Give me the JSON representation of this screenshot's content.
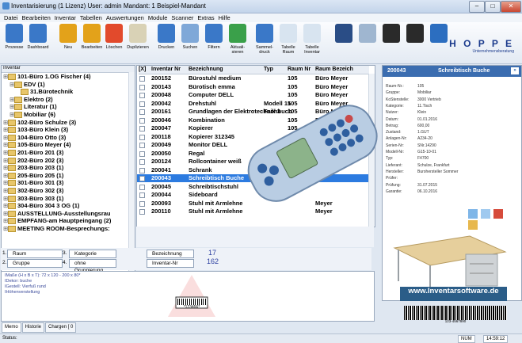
{
  "window": {
    "title": "Inventarisierung (1 Lizenz)  User: admin  Mandant: 1 Beispiel-Mandant"
  },
  "menu": [
    "Datei",
    "Bearbeiten",
    "Inventar",
    "Tabellen",
    "Auswertungen",
    "Module",
    "Scanner",
    "Extras",
    "Hilfe"
  ],
  "toolbar": [
    {
      "label": "Prozesse",
      "icon": "process-icon",
      "color": "#3a78c8"
    },
    {
      "label": "Dashboard",
      "icon": "dashboard-icon",
      "color": "#3a78c8"
    },
    {
      "label": "Neu",
      "icon": "new-icon",
      "color": "#e3a21a"
    },
    {
      "label": "Bearbeiten",
      "icon": "edit-icon",
      "color": "#e3a21a"
    },
    {
      "label": "Löschen",
      "icon": "delete-icon",
      "color": "#e24a2c"
    },
    {
      "label": "Duplizieren",
      "icon": "duplicate-icon",
      "color": "#d9d2b6"
    },
    {
      "label": "Drucken",
      "icon": "print-icon",
      "color": "#3a78c8"
    },
    {
      "label": "Suchen",
      "icon": "search-icon",
      "color": "#7fa8d8"
    },
    {
      "label": "Filtern",
      "icon": "filter-icon",
      "color": "#3a78c8"
    },
    {
      "label": "Aktuali- sieren",
      "icon": "refresh-icon",
      "color": "#3aa04a"
    },
    {
      "label": "Sammel- druck",
      "icon": "batch-print-icon",
      "color": "#3a78c8"
    },
    {
      "label": "Tabelle Raum",
      "icon": "table-room-icon",
      "color": "#d8e4f0"
    },
    {
      "label": "Tabelle Inventar",
      "icon": "table-inventory-icon",
      "color": "#d8e4f0"
    },
    {
      "label": "",
      "icon": "phone-icon",
      "color": "#2a4d86"
    },
    {
      "label": "",
      "icon": "scanner-icon",
      "color": "#9fb6d0"
    },
    {
      "label": "",
      "icon": "rfid-icon",
      "color": "#2a2a2a"
    },
    {
      "label": "",
      "icon": "camera-icon",
      "color": "#2a2a2a"
    },
    {
      "label": "",
      "icon": "help-icon",
      "color": "#2c6ec0"
    }
  ],
  "brand": {
    "name": "H O P P E",
    "tagline": "Unternehmensberatung"
  },
  "tree": {
    "header": "Inventar",
    "nodes": [
      {
        "label": "101-Büro 1.OG  Fischer  (4)",
        "level": 0
      },
      {
        "label": "EDV  (1)",
        "level": 1
      },
      {
        "label": "31.Bürotechnik",
        "level": 2
      },
      {
        "label": "Elektro  (2)",
        "level": 1
      },
      {
        "label": "Literatur  (1)",
        "level": 1
      },
      {
        "label": "Mobiliar  (6)",
        "level": 1
      },
      {
        "label": "102-Büro  Schulze  (3)",
        "level": 0
      },
      {
        "label": "103-Büro Klein  (3)",
        "level": 0
      },
      {
        "label": "104-Büro  Otto  (3)",
        "level": 0
      },
      {
        "label": "105-Büro  Meyer  (4)",
        "level": 0
      },
      {
        "label": "201-Büro 201  (3)",
        "level": 0
      },
      {
        "label": "202-Büro 202  (3)",
        "level": 0
      },
      {
        "label": "203-Büro 203  (1)",
        "level": 0
      },
      {
        "label": "205-Büro 205  (1)",
        "level": 0
      },
      {
        "label": "301-Büro 301  (3)",
        "level": 0
      },
      {
        "label": "302-Büro 302  (3)",
        "level": 0
      },
      {
        "label": "303-Büro 303  (1)",
        "level": 0
      },
      {
        "label": "304-Büro 304  3 OG  (1)",
        "level": 0
      },
      {
        "label": "AUSSTELLUNG-Ausstellungsrau",
        "level": 0
      },
      {
        "label": "EMPFANG-am Hauptpeingang  (2)",
        "level": 0
      },
      {
        "label": "MEETING ROOM-Besprechungs:",
        "level": 0
      }
    ]
  },
  "grid": {
    "columns": [
      "[X]",
      "Inventar Nr",
      "Bezeichnung",
      "Typ",
      "Raum Nr",
      "Raum Bezeich"
    ],
    "rows": [
      {
        "nr": "200152",
        "bez": "Bürostuhl medium",
        "typ": "",
        "raum": "105",
        "rbez": "Büro  Meyer"
      },
      {
        "nr": "200143",
        "bez": "Bürotisch emma",
        "typ": "",
        "raum": "105",
        "rbez": "Büro  Meyer"
      },
      {
        "nr": "200048",
        "bez": "Computer DELL",
        "typ": "",
        "raum": "105",
        "rbez": "Büro  Meyer"
      },
      {
        "nr": "200042",
        "bez": "Drehstuhl",
        "typ": "Modell 15",
        "raum": "105",
        "rbez": "Büro  Meyer"
      },
      {
        "nr": "200161",
        "bez": "Grundlagen der Elektrotechnik 3",
        "typ": "Fachbuch",
        "raum": "105",
        "rbez": "Büro  Meyer"
      },
      {
        "nr": "200046",
        "bez": "Kombination",
        "typ": "",
        "raum": "105",
        "rbez": "Büro  Meyer"
      },
      {
        "nr": "200047",
        "bez": "Kopierer",
        "typ": "",
        "raum": "105",
        "rbez": "Büro  Meyer"
      },
      {
        "nr": "200118",
        "bez": "Kopierer 312345",
        "typ": "",
        "raum": "105",
        "rbez": ""
      },
      {
        "nr": "200049",
        "bez": "Monitor DELL",
        "typ": "",
        "raum": "",
        "rbez": ""
      },
      {
        "nr": "200050",
        "bez": "Regal",
        "typ": "",
        "raum": "",
        "rbez": ""
      },
      {
        "nr": "200124",
        "bez": "Rollcontainer weiß",
        "typ": "",
        "raum": "",
        "rbez": ""
      },
      {
        "nr": "200041",
        "bez": "Schrank",
        "typ": "Mo",
        "raum": "",
        "rbez": ""
      },
      {
        "nr": "200043",
        "bez": "Schreibtisch Buche",
        "typ": "",
        "raum": "",
        "rbez": "",
        "selected": true
      },
      {
        "nr": "200045",
        "bez": "Schreibtischstuhl",
        "typ": "",
        "raum": "",
        "rbez": ""
      },
      {
        "nr": "200044",
        "bez": "Sideboard",
        "typ": "",
        "raum": "",
        "rbez": ""
      },
      {
        "nr": "200093",
        "bez": "Stuhl mit Armlehne",
        "typ": "",
        "raum": "",
        "rbez": "Meyer"
      },
      {
        "nr": "200110",
        "bez": "Stuhl mit Armlehne",
        "typ": "",
        "raum": "",
        "rbez": "Meyer"
      }
    ]
  },
  "grouping": {
    "row1": {
      "a_num": "1.",
      "a": "Raum",
      "b_num": "3.",
      "b": "Kategorie",
      "c": "Bezeichnung",
      "count": "17"
    },
    "row2": {
      "a_num": "2.",
      "a": "Gruppe",
      "b_num": "4.",
      "b": "ohne Gruppierung",
      "c": "Inventar-Nr",
      "count": "162"
    }
  },
  "memo": {
    "lines": [
      "IMaße (H x B x T): 72 x 120 - 200 x 80*",
      "IDekor: buche",
      "IGestell: Vierfuß rund",
      "IHöhenverstellung"
    ]
  },
  "barcode_text": "*123456*",
  "tabs": [
    "Memo",
    "Historie",
    "Chargen [ 0"
  ],
  "status": {
    "left": "Status:",
    "num": "NUM",
    "time": "14:59:12"
  },
  "detail": {
    "nr": "200043",
    "title": "Schreibtisch Buche",
    "fields": [
      {
        "k": "Raum-Nr.:",
        "v": "105"
      },
      {
        "k": "Gruppe:",
        "v": "Mobiliar"
      },
      {
        "k": "KoStenstelle:",
        "v": "3000 Vertrieb"
      },
      {
        "k": "Kategorie:",
        "v": "11.Tisch"
      },
      {
        "k": "Nutzer:",
        "v": "Klein"
      },
      {
        "k": "Datum:",
        "v": "01.01.2016"
      },
      {
        "k": "Betrag:",
        "v": "600,00"
      },
      {
        "k": "Zustand:",
        "v": "1.GUT"
      },
      {
        "k": "Anlagen-Nr:",
        "v": "A234-20"
      },
      {
        "k": "Serien-Nr:",
        "v": "SNr.14290"
      },
      {
        "k": "Modell-Nr:",
        "v": "G15-10-01"
      },
      {
        "k": "Typ:",
        "v": "F4700"
      },
      {
        "k": "Lieferant:",
        "v": "Schulze, Frankfurt"
      },
      {
        "k": "Hersteller:",
        "v": "Burohersteller Sommer"
      },
      {
        "k": "Prüfer:",
        "v": ""
      },
      {
        "k": "Prüfung:",
        "v": "31.07.2015"
      },
      {
        "k": "Garantie:",
        "v": "06.10.2016"
      }
    ],
    "banner": "www.Inventarsoftware.de",
    "barcode_caption": "123-4567890"
  }
}
